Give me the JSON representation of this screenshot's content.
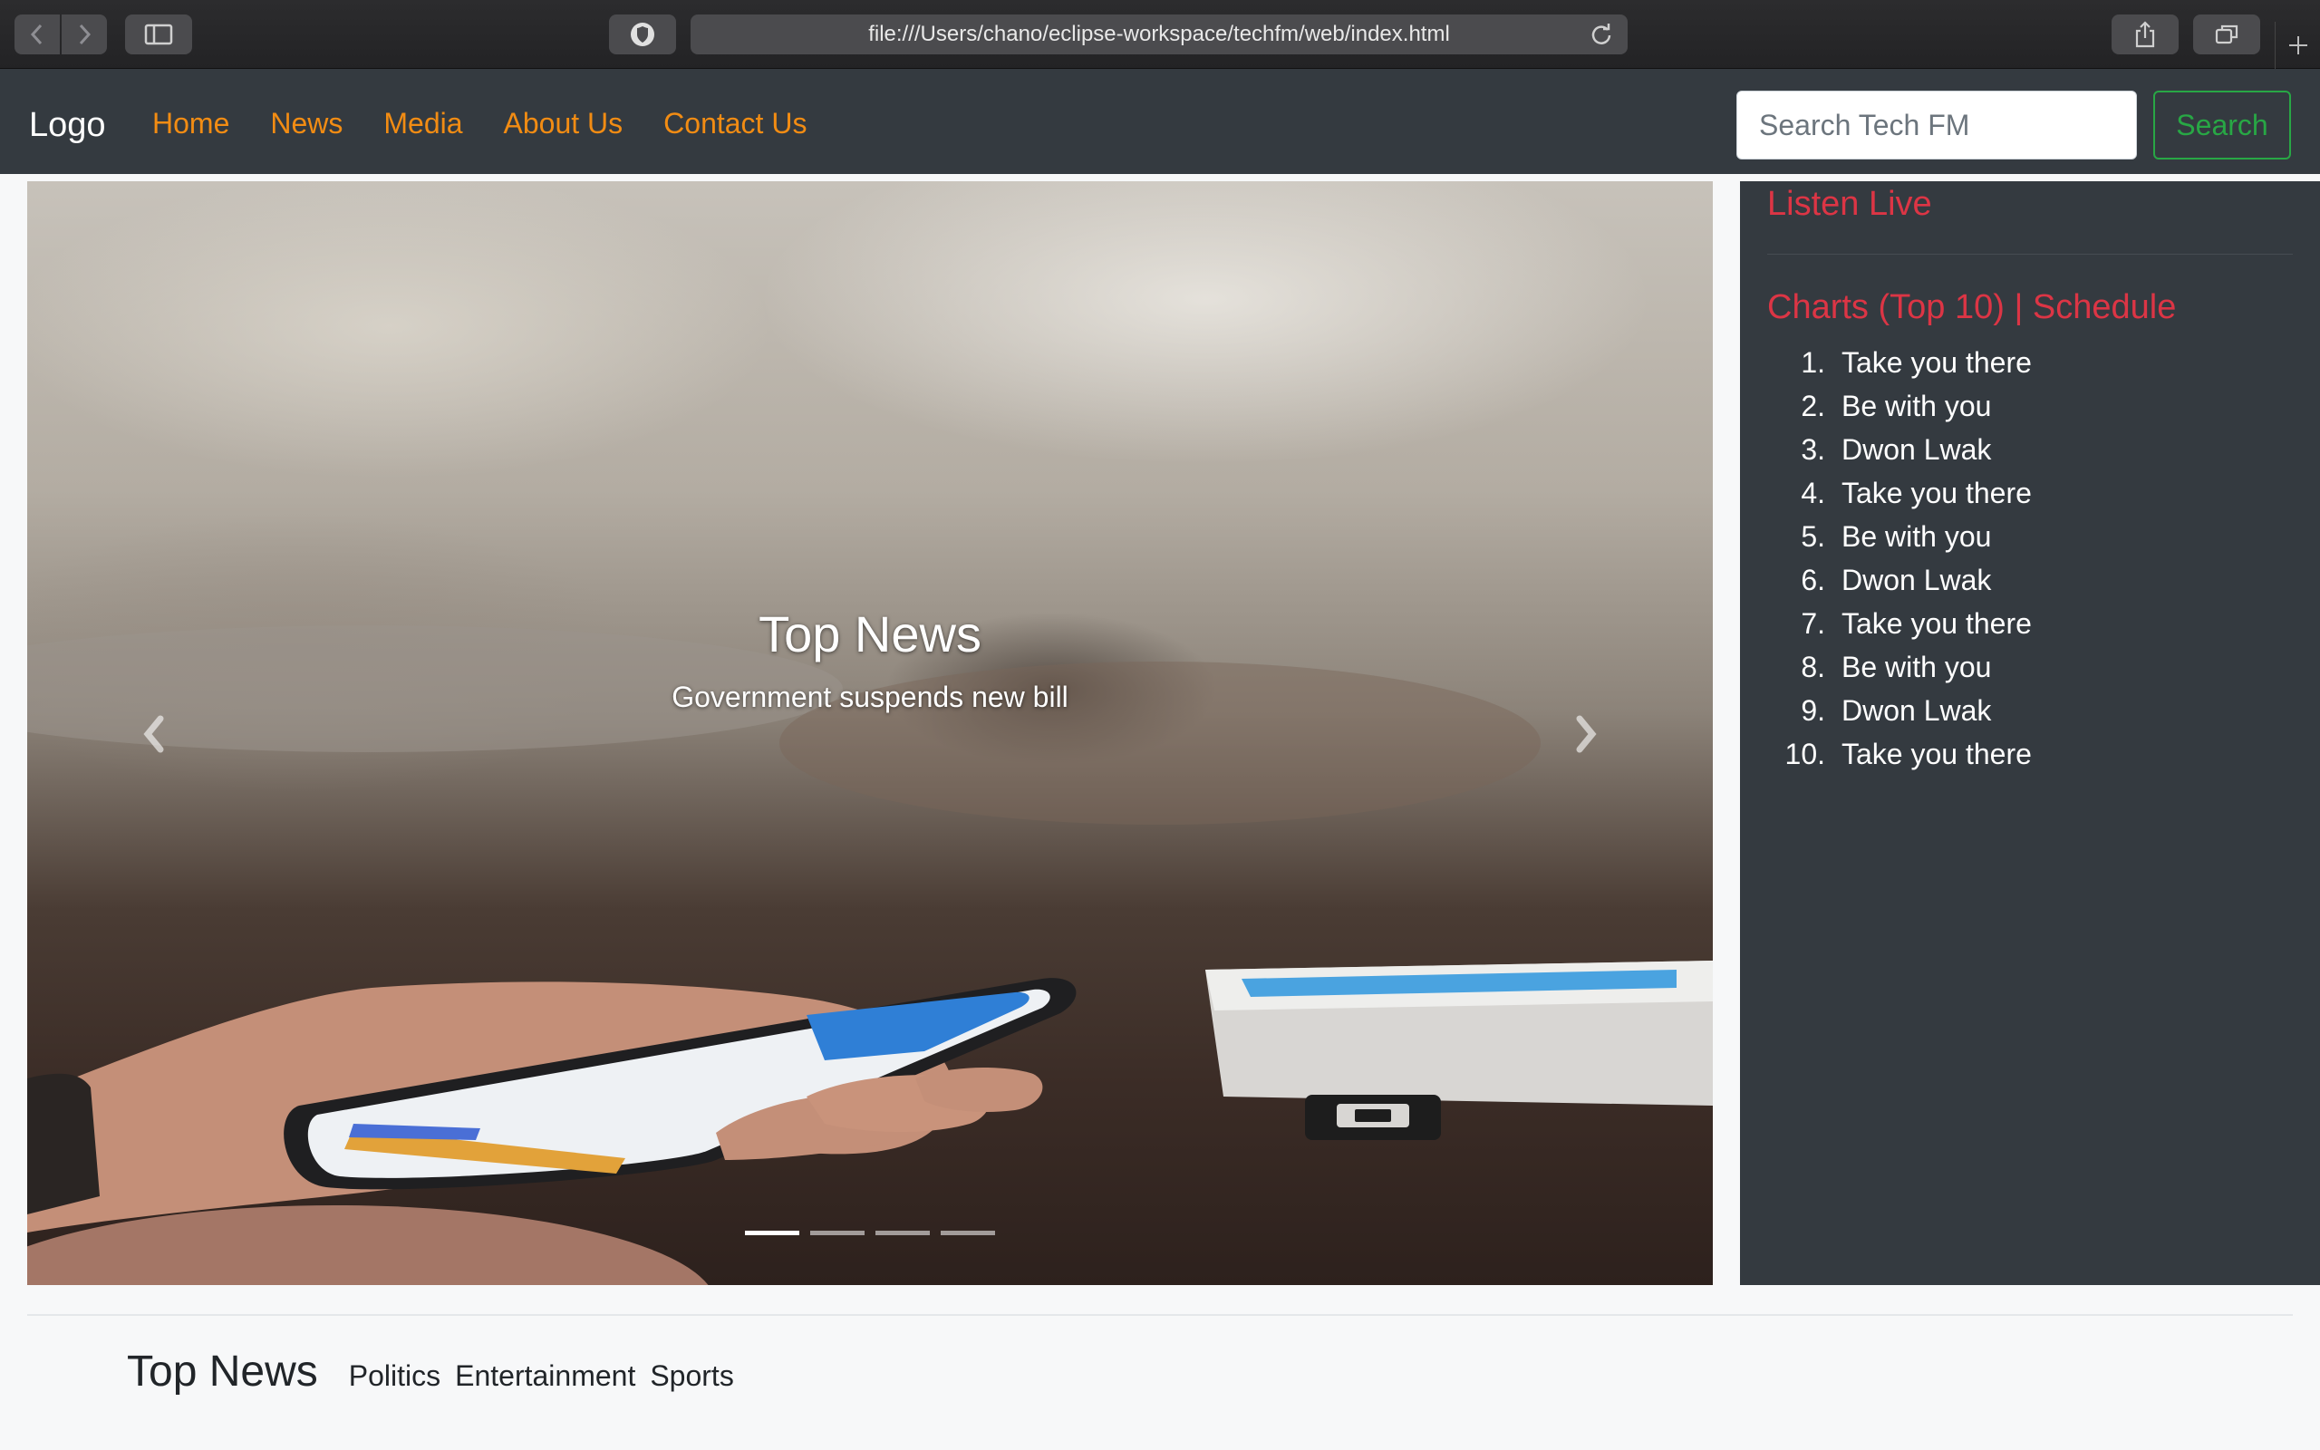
{
  "browser": {
    "url": "file:///Users/chano/eclipse-workspace/techfm/web/index.html"
  },
  "navbar": {
    "brand": "Logo",
    "links": [
      "Home",
      "News",
      "Media",
      "About Us",
      "Contact Us"
    ],
    "search_placeholder": "Search Tech FM",
    "search_button": "Search"
  },
  "carousel": {
    "caption_title": "Top News",
    "caption_text": "Government suspends new bill",
    "slide_count": 4,
    "active_slide": 1
  },
  "sidebar": {
    "listen_live": "Listen Live",
    "charts_heading": "Charts (Top 10) | Schedule",
    "charts": [
      {
        "num": "1.",
        "title": "Take you there"
      },
      {
        "num": "2.",
        "title": "Be with you"
      },
      {
        "num": "3.",
        "title": "Dwon Lwak"
      },
      {
        "num": "4.",
        "title": "Take you there"
      },
      {
        "num": "5.",
        "title": "Be with you"
      },
      {
        "num": "6.",
        "title": "Dwon Lwak"
      },
      {
        "num": "7.",
        "title": "Take you there"
      },
      {
        "num": "8.",
        "title": "Be with you"
      },
      {
        "num": "9.",
        "title": "Dwon Lwak"
      },
      {
        "num": "10.",
        "title": "Take you there"
      }
    ]
  },
  "bottom_nav": {
    "title": "Top News",
    "links": [
      "Politics",
      "Entertainment",
      "Sports"
    ]
  },
  "colors": {
    "nav_bg": "#343a40",
    "nav_link": "#f28c13",
    "accent_red": "#dc3545",
    "search_green": "#28a745"
  }
}
